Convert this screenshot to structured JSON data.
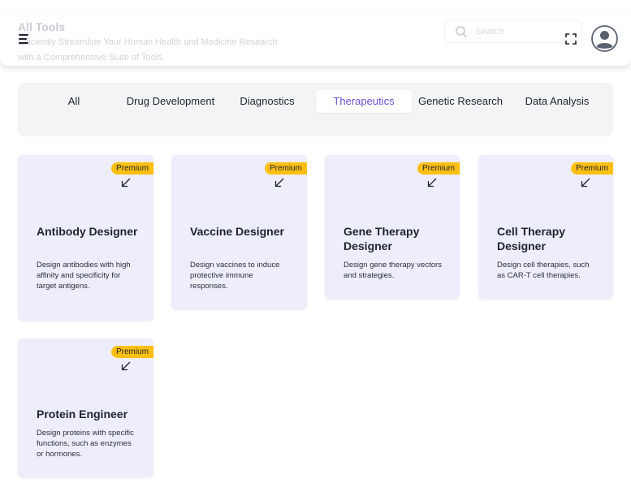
{
  "header": {
    "title": "All Tools",
    "subtitle": "Efficiently Streamline Your Human Health and Medicine Research with a Comprehensive Suite of Tools.",
    "search_placeholder": "Search"
  },
  "icons": {
    "menu": "menu-icon",
    "search": "search-icon",
    "expand": "fullscreen-icon",
    "avatar": "user-avatar-icon",
    "card_arrow": "arrow-down-left-icon"
  },
  "colors": {
    "accent": "#6b4fd8",
    "card_bg": "#eeedfb",
    "badge": "#fdc012",
    "tabs_bg": "#f3f4f6"
  },
  "tabs": [
    {
      "label": "All",
      "active": false
    },
    {
      "label": "Drug Development",
      "active": false
    },
    {
      "label": "Diagnostics",
      "active": false
    },
    {
      "label": "Therapeutics",
      "active": true
    },
    {
      "label": "Genetic Research",
      "active": false
    },
    {
      "label": "Data Analysis",
      "active": false
    }
  ],
  "cards": [
    {
      "badge": "Premium",
      "title": "Antibody Designer",
      "description": "Design antibodies with high affinity and specificity for target antigens."
    },
    {
      "badge": "Premium",
      "title": "Vaccine Designer",
      "description": "Design vaccines to induce protective immune responses."
    },
    {
      "badge": "Premium",
      "title": "Gene Therapy Designer",
      "description": "Design gene therapy vectors and strategies."
    },
    {
      "badge": "Premium",
      "title": "Cell Therapy Designer",
      "description": "Design cell therapies, such as CAR-T cell therapies."
    },
    {
      "badge": "Premium",
      "title": "Protein Engineer",
      "description": "Design proteins with specific functions, such as enzymes or hormones."
    }
  ]
}
